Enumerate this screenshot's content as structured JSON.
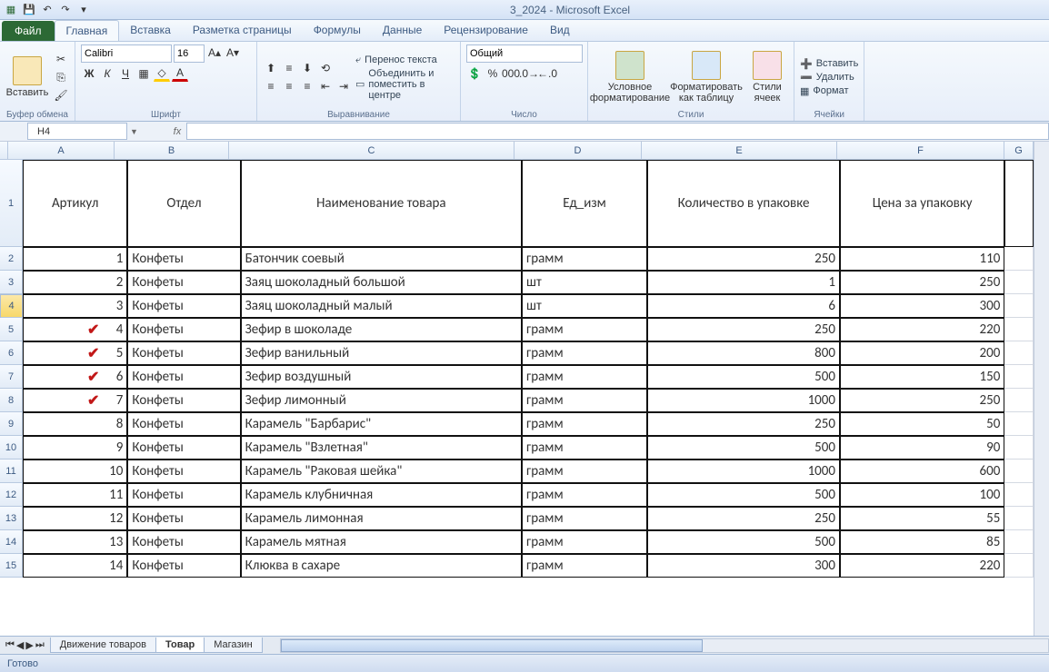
{
  "app": {
    "title": "3_2024 - Microsoft Excel"
  },
  "qat": {
    "save": "💾",
    "undo": "↶",
    "redo": "↷"
  },
  "tabs": {
    "file": "Файл",
    "items": [
      "Главная",
      "Вставка",
      "Разметка страницы",
      "Формулы",
      "Данные",
      "Рецензирование",
      "Вид"
    ],
    "active": 0
  },
  "ribbon": {
    "clipboard": {
      "label": "Буфер обмена",
      "paste": "Вставить"
    },
    "font": {
      "label": "Шрифт",
      "name": "Calibri",
      "size": "16"
    },
    "align": {
      "label": "Выравнивание",
      "wrap": "Перенос текста",
      "merge": "Объединить и поместить в центре"
    },
    "number": {
      "label": "Число",
      "format": "Общий"
    },
    "styles": {
      "label": "Стили",
      "cond": "Условное форматирование",
      "table": "Форматировать как таблицу",
      "cell": "Стили ячеек"
    },
    "cells": {
      "label": "Ячейки",
      "insert": "Вставить",
      "delete": "Удалить",
      "format": "Формат"
    }
  },
  "namebox": "H4",
  "columns": [
    "A",
    "B",
    "C",
    "D",
    "E",
    "F",
    "G"
  ],
  "headers": {
    "A": "Артикул",
    "B": "Отдел",
    "C": "Наименование товара",
    "D": "Ед_изм",
    "E": "Количество в упаковке",
    "F": "Цена за упаковку"
  },
  "rows": [
    {
      "n": 2,
      "A": "1",
      "B": "Конфеты",
      "C": "Батончик соевый",
      "D": "грамм",
      "E": "250",
      "F": "110"
    },
    {
      "n": 3,
      "A": "2",
      "B": "Конфеты",
      "C": "Заяц шоколадный большой",
      "D": "шт",
      "E": "1",
      "F": "250"
    },
    {
      "n": 4,
      "A": "3",
      "B": "Конфеты",
      "C": "Заяц шоколадный малый",
      "D": "шт",
      "E": "6",
      "F": "300"
    },
    {
      "n": 5,
      "A": "4",
      "B": "Конфеты",
      "C": "Зефир в шоколаде",
      "D": "грамм",
      "E": "250",
      "F": "220",
      "chk": true
    },
    {
      "n": 6,
      "A": "5",
      "B": "Конфеты",
      "C": "Зефир ванильный",
      "D": "грамм",
      "E": "800",
      "F": "200",
      "chk": true
    },
    {
      "n": 7,
      "A": "6",
      "B": "Конфеты",
      "C": "Зефир воздушный",
      "D": "грамм",
      "E": "500",
      "F": "150",
      "chk": true
    },
    {
      "n": 8,
      "A": "7",
      "B": "Конфеты",
      "C": "Зефир лимонный",
      "D": "грамм",
      "E": "1000",
      "F": "250",
      "chk": true
    },
    {
      "n": 9,
      "A": "8",
      "B": "Конфеты",
      "C": "Карамель \"Барбарис\"",
      "D": "грамм",
      "E": "250",
      "F": "50"
    },
    {
      "n": 10,
      "A": "9",
      "B": "Конфеты",
      "C": "Карамель \"Взлетная\"",
      "D": "грамм",
      "E": "500",
      "F": "90"
    },
    {
      "n": 11,
      "A": "10",
      "B": "Конфеты",
      "C": "Карамель \"Раковая шейка\"",
      "D": "грамм",
      "E": "1000",
      "F": "600"
    },
    {
      "n": 12,
      "A": "11",
      "B": "Конфеты",
      "C": "Карамель клубничная",
      "D": "грамм",
      "E": "500",
      "F": "100"
    },
    {
      "n": 13,
      "A": "12",
      "B": "Конфеты",
      "C": "Карамель лимонная",
      "D": "грамм",
      "E": "250",
      "F": "55"
    },
    {
      "n": 14,
      "A": "13",
      "B": "Конфеты",
      "C": "Карамель мятная",
      "D": "грамм",
      "E": "500",
      "F": "85"
    },
    {
      "n": 15,
      "A": "14",
      "B": "Конфеты",
      "C": "Клюква в сахаре",
      "D": "грамм",
      "E": "300",
      "F": "220"
    }
  ],
  "selected_row": 4,
  "sheets": {
    "items": [
      "Движение товаров",
      "Товар",
      "Магазин"
    ],
    "active": 1
  },
  "status": "Готово"
}
